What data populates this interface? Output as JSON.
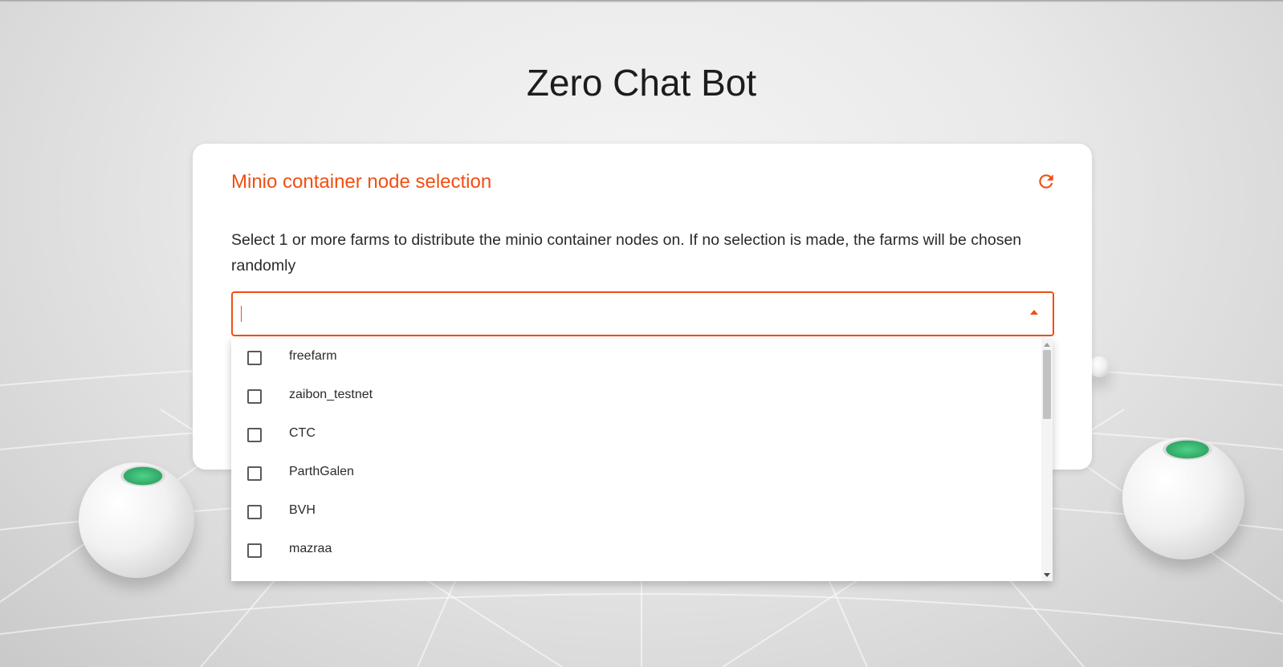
{
  "app": {
    "title": "Zero Chat Bot"
  },
  "card": {
    "title": "Minio container node selection",
    "description": "Select 1 or more farms to distribute the minio container nodes on. If no selection is made, the farms will be chosen randomly"
  },
  "select": {
    "value": "",
    "options": [
      "freefarm",
      "zaibon_testnet",
      "CTC",
      "ParthGalen",
      "BVH",
      "mazraa"
    ]
  },
  "colors": {
    "accent": "#f24e12",
    "text": "#2a2a2a"
  }
}
